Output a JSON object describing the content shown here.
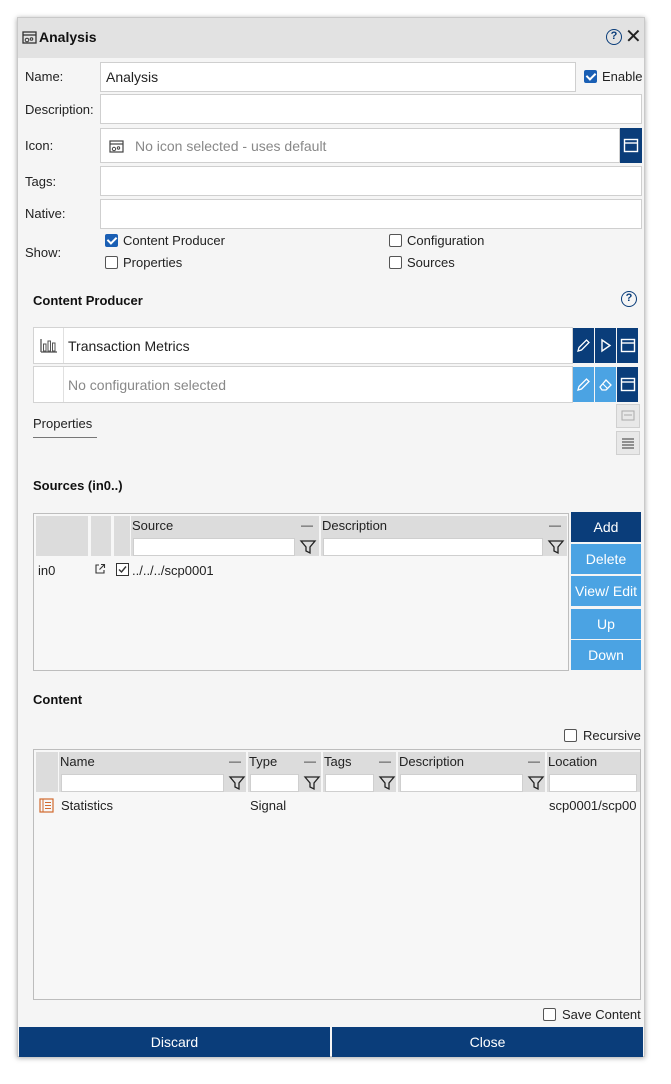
{
  "window": {
    "title": "Analysis",
    "help_label": "?"
  },
  "form": {
    "name_label": "Name:",
    "name_value": "Analysis",
    "enable_label": "Enable",
    "description_label": "Description:",
    "description_value": "",
    "icon_label": "Icon:",
    "icon_placeholder": "No icon selected - uses default",
    "tags_label": "Tags:",
    "tags_value": "",
    "native_label": "Native:",
    "native_value": "",
    "show_label": "Show:",
    "show_options": [
      {
        "label": "Content Producer",
        "checked": true
      },
      {
        "label": "Configuration",
        "checked": false
      },
      {
        "label": "Properties",
        "checked": false
      },
      {
        "label": "Sources",
        "checked": false
      }
    ]
  },
  "content_producer": {
    "title": "Content Producer",
    "producer_name": "Transaction Metrics",
    "configuration_placeholder": "No configuration selected",
    "tab_label": "Properties"
  },
  "sources": {
    "title": "Sources (in0..)",
    "columns": [
      "Source",
      "Description"
    ],
    "rows": [
      {
        "port": "in0",
        "source": "../../../scp0001",
        "checked": true
      }
    ],
    "buttons": [
      "Add",
      "Delete",
      "View/ Edit",
      "Up",
      "Down"
    ]
  },
  "content": {
    "title": "Content",
    "recursive_label": "Recursive",
    "columns": [
      "Name",
      "Type",
      "Tags",
      "Description",
      "Location"
    ],
    "rows": [
      {
        "name": "Statistics",
        "type": "Signal",
        "tags": "",
        "description": "",
        "location": "scp0001/scp00"
      }
    ],
    "save_content_label": "Save Content"
  },
  "footer": {
    "discard_label": "Discard",
    "close_label": "Close"
  },
  "colors": {
    "primary": "#0a3d7a",
    "secondary": "#4ba3e3",
    "panel": "#f5f5f5"
  }
}
